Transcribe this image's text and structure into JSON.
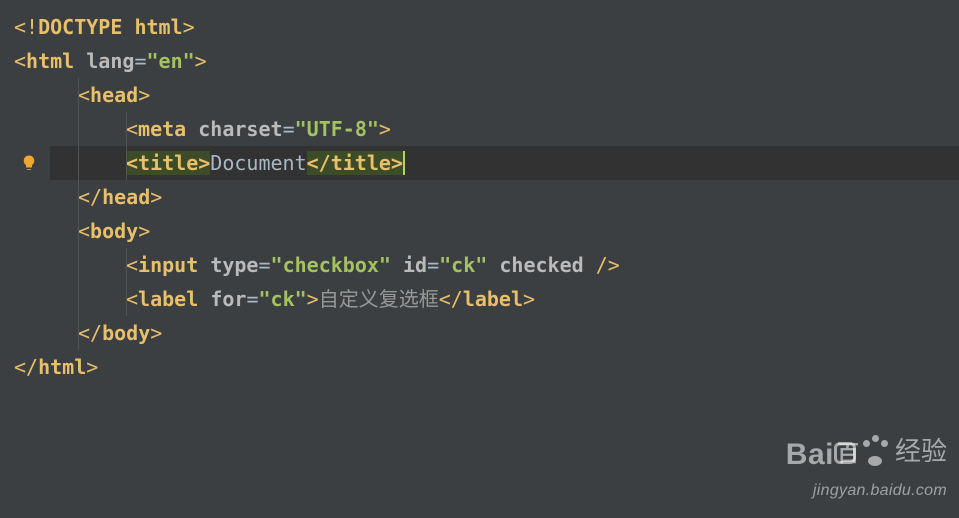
{
  "colors": {
    "background": "#3b3f41",
    "current_line": "#323232",
    "tag": "#e8bf6a",
    "attr": "#bababa",
    "string": "#a5c261",
    "highlight_bg": "#3c4b28",
    "caret": "#b0d75c"
  },
  "icons": {
    "bulb": "lightbulb-icon"
  },
  "watermark": {
    "brand": "Bai",
    "brand_boxed": "百",
    "cn": "经验",
    "url": "jingyan.baidu.com"
  },
  "code": {
    "current_line_index": 4,
    "lines": [
      {
        "indent": 0,
        "tokens": [
          {
            "t": "tag-angle",
            "v": "<!"
          },
          {
            "t": "tag-name",
            "v": "DOCTYPE"
          },
          {
            "t": "text",
            "v": " "
          },
          {
            "t": "tag-name",
            "v": "html"
          },
          {
            "t": "tag-angle",
            "v": ">"
          }
        ]
      },
      {
        "indent": 0,
        "tokens": [
          {
            "t": "tag-angle",
            "v": "<"
          },
          {
            "t": "tag-name",
            "v": "html"
          },
          {
            "t": "text",
            "v": " "
          },
          {
            "t": "attr",
            "v": "lang"
          },
          {
            "t": "eq",
            "v": "="
          },
          {
            "t": "string",
            "v": "\"en\""
          },
          {
            "t": "tag-angle",
            "v": ">"
          }
        ]
      },
      {
        "indent": 1,
        "tokens": [
          {
            "t": "tag-angle",
            "v": "<"
          },
          {
            "t": "tag-name",
            "v": "head"
          },
          {
            "t": "tag-angle",
            "v": ">"
          }
        ]
      },
      {
        "indent": 2,
        "tokens": [
          {
            "t": "tag-angle",
            "v": "<"
          },
          {
            "t": "tag-name",
            "v": "meta"
          },
          {
            "t": "text",
            "v": " "
          },
          {
            "t": "attr",
            "v": "charset"
          },
          {
            "t": "eq",
            "v": "="
          },
          {
            "t": "string",
            "v": "\"UTF-8\""
          },
          {
            "t": "tag-angle",
            "v": ">"
          }
        ]
      },
      {
        "indent": 2,
        "tokens": [
          {
            "t": "hl-tag",
            "v": "<title>"
          },
          {
            "t": "text",
            "v": "Document"
          },
          {
            "t": "hl-tag",
            "v": "</title>"
          },
          {
            "t": "caret",
            "v": ""
          }
        ]
      },
      {
        "indent": 1,
        "tokens": [
          {
            "t": "tag-angle",
            "v": "</"
          },
          {
            "t": "tag-name",
            "v": "head"
          },
          {
            "t": "tag-angle",
            "v": ">"
          }
        ]
      },
      {
        "indent": 1,
        "tokens": [
          {
            "t": "tag-angle",
            "v": "<"
          },
          {
            "t": "tag-name",
            "v": "body"
          },
          {
            "t": "tag-angle",
            "v": ">"
          }
        ]
      },
      {
        "indent": 2,
        "tokens": [
          {
            "t": "tag-angle",
            "v": "<"
          },
          {
            "t": "tag-name",
            "v": "input"
          },
          {
            "t": "text",
            "v": " "
          },
          {
            "t": "attr",
            "v": "type"
          },
          {
            "t": "eq",
            "v": "="
          },
          {
            "t": "string",
            "v": "\"checkbox\""
          },
          {
            "t": "text",
            "v": " "
          },
          {
            "t": "attr",
            "v": "id"
          },
          {
            "t": "eq",
            "v": "="
          },
          {
            "t": "string",
            "v": "\"ck\""
          },
          {
            "t": "text",
            "v": " "
          },
          {
            "t": "attr",
            "v": "checked"
          },
          {
            "t": "text",
            "v": " "
          },
          {
            "t": "tag-angle",
            "v": "/>"
          }
        ]
      },
      {
        "indent": 2,
        "tokens": [
          {
            "t": "tag-angle",
            "v": "<"
          },
          {
            "t": "tag-name",
            "v": "label"
          },
          {
            "t": "text",
            "v": " "
          },
          {
            "t": "attr",
            "v": "for"
          },
          {
            "t": "eq",
            "v": "="
          },
          {
            "t": "string",
            "v": "\"ck\""
          },
          {
            "t": "tag-angle",
            "v": ">"
          },
          {
            "t": "text-cjk",
            "v": "自定义复选框"
          },
          {
            "t": "tag-angle",
            "v": "</"
          },
          {
            "t": "tag-name",
            "v": "label"
          },
          {
            "t": "tag-angle",
            "v": ">"
          }
        ]
      },
      {
        "indent": 1,
        "tokens": [
          {
            "t": "tag-angle",
            "v": "</"
          },
          {
            "t": "tag-name",
            "v": "body"
          },
          {
            "t": "tag-angle",
            "v": ">"
          }
        ]
      },
      {
        "indent": 0,
        "tokens": [
          {
            "t": "tag-angle",
            "v": "</"
          },
          {
            "t": "tag-name",
            "v": "html"
          },
          {
            "t": "tag-angle",
            "v": ">"
          }
        ]
      }
    ]
  }
}
